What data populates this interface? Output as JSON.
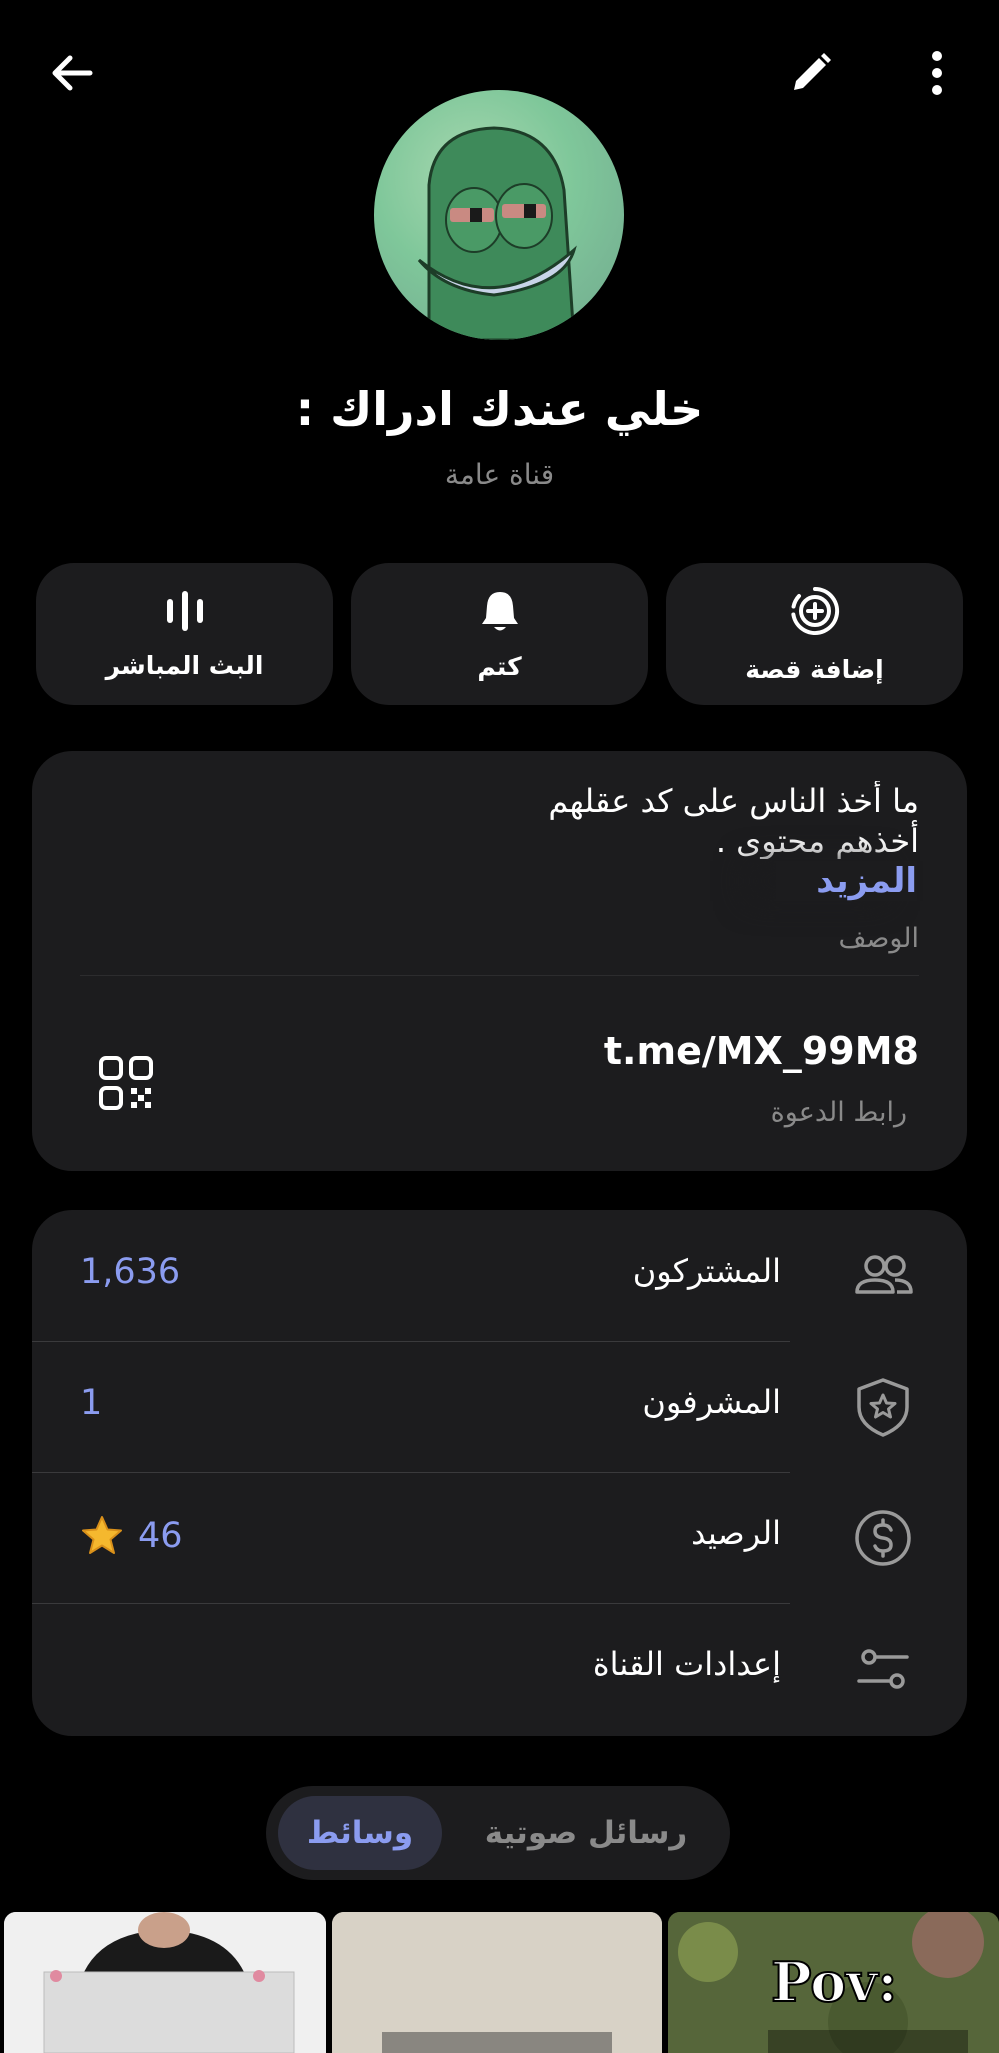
{
  "header": {
    "back_icon": "arrow-left-icon",
    "edit_icon": "pencil-icon",
    "more_icon": "dots-vertical-icon"
  },
  "channel": {
    "title": "خلي عندك ادراك :",
    "subtitle": "قناة عامة"
  },
  "actions": [
    {
      "label": "إضافة قصة",
      "icon": "add-story-icon"
    },
    {
      "label": "كتم",
      "icon": "bell-icon"
    },
    {
      "label": "البث المباشر",
      "icon": "live-stream-icon"
    }
  ],
  "about": {
    "bio": "ما أخذ الناس على كد عقلهم\nأخذهم محتوى .",
    "more_label": "المزيد",
    "description_label": "الوصف",
    "invite_link": "t.me/MX_99M8",
    "invite_label": "رابط الدعوة"
  },
  "info": {
    "subscribers": {
      "label": "المشتركون",
      "value": "1,636"
    },
    "admins": {
      "label": "المشرفون",
      "value": "1"
    },
    "balance": {
      "label": "الرصيد",
      "value": "46"
    },
    "settings": {
      "label": "إعدادات القناة"
    }
  },
  "tabs": {
    "media": "وسائط",
    "voice": "رسائل صوتية"
  },
  "thumbs": {
    "third_caption": "Pov:"
  },
  "colors": {
    "accent": "#8b9cf0",
    "card": "#1c1c1e",
    "background": "#000000",
    "muted": "#8a8a8a"
  }
}
